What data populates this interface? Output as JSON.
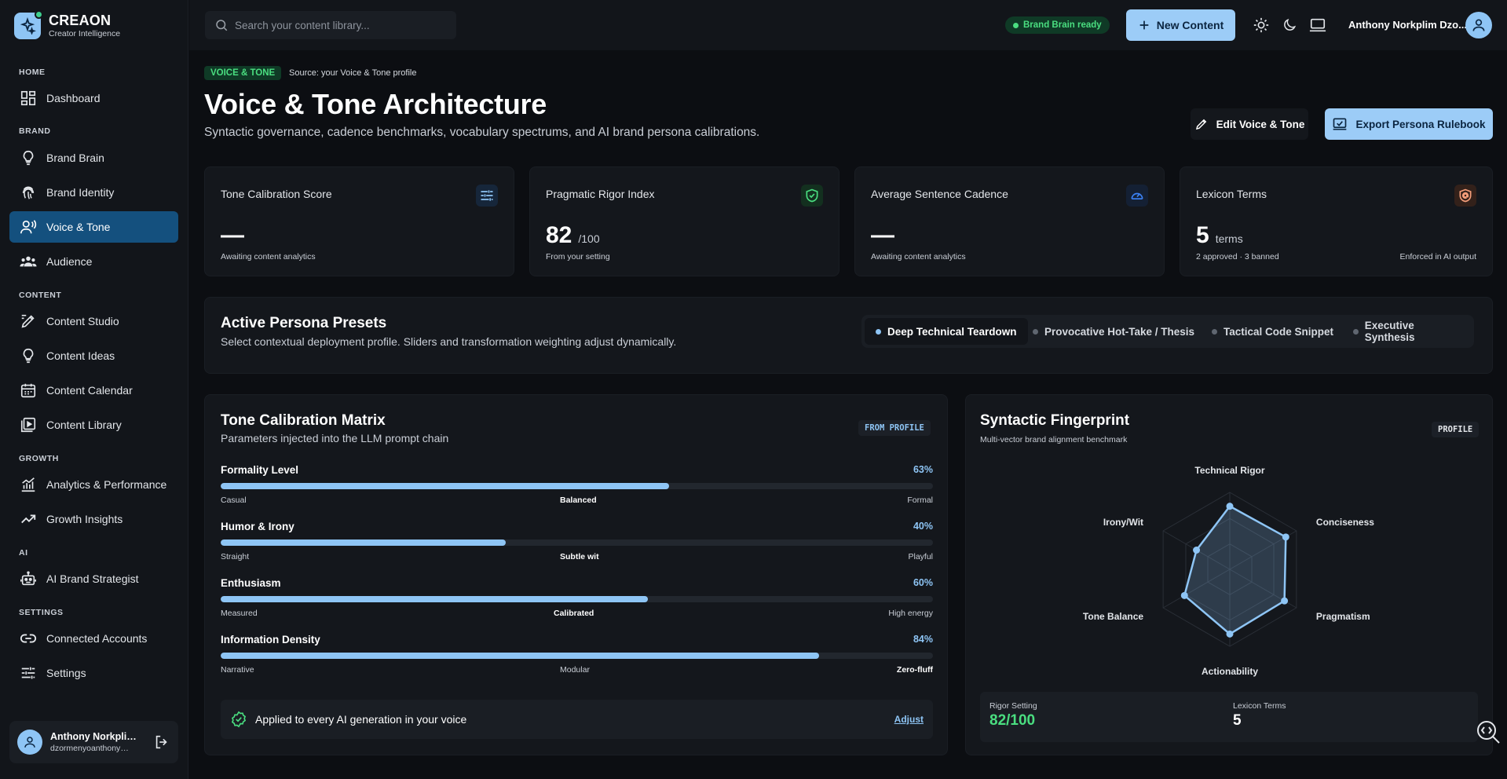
{
  "brand": {
    "name": "CREAON",
    "tagline": "Creator Intelligence"
  },
  "sidebar": {
    "sections": [
      {
        "label": "HOME",
        "items": [
          {
            "label": "Dashboard",
            "icon": "dashboard-icon"
          }
        ]
      },
      {
        "label": "BRAND",
        "items": [
          {
            "label": "Brand Brain",
            "icon": "bulb-icon"
          },
          {
            "label": "Brand Identity",
            "icon": "fingerprint-icon"
          },
          {
            "label": "Voice & Tone",
            "icon": "voice-icon",
            "active": true
          },
          {
            "label": "Audience",
            "icon": "audience-icon"
          }
        ]
      },
      {
        "label": "CONTENT",
        "items": [
          {
            "label": "Content Studio",
            "icon": "pen-icon"
          },
          {
            "label": "Content Ideas",
            "icon": "bulb-icon"
          },
          {
            "label": "Content Calendar",
            "icon": "calendar-icon"
          },
          {
            "label": "Content Library",
            "icon": "library-icon"
          }
        ]
      },
      {
        "label": "GROWTH",
        "items": [
          {
            "label": "Analytics & Performance",
            "icon": "analytics-icon"
          },
          {
            "label": "Growth Insights",
            "icon": "trending-icon"
          }
        ]
      },
      {
        "label": "AI",
        "items": [
          {
            "label": "AI Brand Strategist",
            "icon": "robot-icon"
          }
        ]
      },
      {
        "label": "SETTINGS",
        "items": [
          {
            "label": "Connected Accounts",
            "icon": "link-icon"
          },
          {
            "label": "Settings",
            "icon": "sliders-icon"
          }
        ]
      }
    ],
    "user": {
      "name": "Anthony Norkplim Dzormenyo",
      "email": "dzormenyoanthony@gmail.com"
    }
  },
  "topbar": {
    "search_placeholder": "Search your content library...",
    "status": "Brand Brain ready",
    "new_content": "New Content",
    "user_name": "Anthony Norkplim Dzo..."
  },
  "header": {
    "chip": "VOICE & TONE",
    "source": "Source: your Voice & Tone profile",
    "title": "Voice & Tone Architecture",
    "subtitle": "Syntactic governance, cadence benchmarks, vocabulary spectrums, and AI brand persona calibrations.",
    "edit_label": "Edit Voice & Tone",
    "export_label": "Export Persona Rulebook"
  },
  "stats": [
    {
      "label": "Tone Calibration Score",
      "value": "—",
      "unit": "",
      "foot": "Awaiting content analytics",
      "foot_right": "",
      "icon": "sliders-icon",
      "color": "#8ec5f5"
    },
    {
      "label": "Pragmatic Rigor Index",
      "value": "82",
      "unit": "/100",
      "foot": "From your setting",
      "foot_right": "",
      "icon": "shield-check-icon",
      "color": "#4ade80"
    },
    {
      "label": "Average Sentence Cadence",
      "value": "—",
      "unit": "",
      "foot": "Awaiting content analytics",
      "foot_right": "",
      "icon": "speedometer-icon",
      "color": "#3b82f6"
    },
    {
      "label": "Lexicon Terms",
      "value": "5",
      "unit": "terms",
      "foot": "2 approved · 3 banned",
      "foot_right": "Enforced in AI output",
      "icon": "shield-at-icon",
      "color": "#f59e7a"
    }
  ],
  "presets": {
    "title": "Active Persona Presets",
    "subtitle": "Select contextual deployment profile. Sliders and transformation weighting adjust dynamically.",
    "tabs": [
      {
        "label": "Deep Technical Teardown",
        "active": true
      },
      {
        "label": "Provocative Hot-Take / Thesis"
      },
      {
        "label": "Tactical Code Snippet"
      },
      {
        "label": "Executive Synthesis"
      }
    ]
  },
  "matrix": {
    "title": "Tone Calibration Matrix",
    "subtitle": "Parameters injected into the LLM prompt chain",
    "badge": "FROM PROFILE",
    "sliders": [
      {
        "name": "Formality Level",
        "pct_label": "63%",
        "value": 63,
        "low": "Casual",
        "mid": "Balanced",
        "high": "Formal",
        "bold": "mid"
      },
      {
        "name": "Humor & Irony",
        "pct_label": "40%",
        "value": 40,
        "low": "Straight",
        "mid": "Subtle wit",
        "high": "Playful",
        "bold": "mid"
      },
      {
        "name": "Enthusiasm",
        "pct_label": "60%",
        "value": 60,
        "low": "Measured",
        "mid": "Calibrated",
        "high": "High energy",
        "bold": "mid"
      },
      {
        "name": "Information Density",
        "pct_label": "84%",
        "value": 84,
        "low": "Narrative",
        "mid": "Modular",
        "high": "Zero-fluff",
        "bold": "high"
      }
    ],
    "applied_text": "Applied to every AI generation in your voice",
    "adjust_label": "Adjust"
  },
  "fingerprint": {
    "title": "Syntactic Fingerprint",
    "subtitle": "Multi-vector brand alignment benchmark",
    "badge": "PROFILE",
    "axes": [
      {
        "label": "Technical Rigor",
        "value": 0.82
      },
      {
        "label": "Conciseness",
        "value": 0.84
      },
      {
        "label": "Pragmatism",
        "value": 0.82
      },
      {
        "label": "Actionability",
        "value": 0.84
      },
      {
        "label": "Tone Balance",
        "value": 0.68
      },
      {
        "label": "Irony/Wit",
        "value": 0.5
      }
    ],
    "metrics": [
      {
        "label": "Rigor Setting",
        "value": "82/100",
        "color": "#4ade80"
      },
      {
        "label": "Lexicon Terms",
        "value": "5",
        "color": "#ffffff"
      }
    ]
  }
}
